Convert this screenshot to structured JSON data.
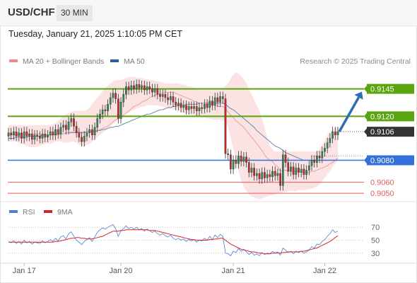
{
  "header": {
    "symbol": "USD/CHF",
    "timeframe": "30 MIN",
    "timestamp": "Tuesday, January 21, 2025 1:10:05 PM CET"
  },
  "legend": [
    {
      "label": "MA 20 + Bollinger Bands",
      "color": "#f08a8a"
    },
    {
      "label": "MA 50",
      "color": "#2e5e9e"
    }
  ],
  "credit": "Research © 2025 Trading Central",
  "rsi_legend": [
    {
      "label": "RSI",
      "color": "#4a7fd4"
    },
    {
      "label": "9MA",
      "color": "#d62728"
    }
  ],
  "colors": {
    "resistance": "#5aa50f",
    "pivot": "#3370d8",
    "support": "#e45a5a",
    "arrow": "#2d6eb2",
    "current_price": "#333333",
    "band_fill": "#fbe3e3"
  },
  "icons": [
    "arrow-up-right-icon",
    "triangle-left-icon"
  ],
  "chart_data": [
    {
      "type": "candlestick",
      "x_ticks": [
        "Jan 17",
        "Jan 20",
        "Jan 21",
        "Jan 22"
      ],
      "ylim": [
        0.9043,
        0.9166
      ],
      "current_price": "0.9106",
      "levels": [
        {
          "value": "0.9145",
          "kind": "resistance"
        },
        {
          "value": "0.9120",
          "kind": "resistance"
        },
        {
          "value": "0.9080",
          "kind": "pivot"
        },
        {
          "value": "0.9060",
          "kind": "support"
        },
        {
          "value": "0.9050",
          "kind": "support"
        }
      ],
      "forecast": {
        "from": 0.9106,
        "to": 0.9145,
        "direction": "up"
      },
      "close_series": [
        0.9105,
        0.9103,
        0.9106,
        0.9102,
        0.9105,
        0.91,
        0.9106,
        0.9102,
        0.9104,
        0.9099,
        0.9103,
        0.9102,
        0.91,
        0.9104,
        0.9101,
        0.9103,
        0.9106,
        0.9103,
        0.9108,
        0.9104,
        0.911,
        0.9112,
        0.9108,
        0.9115,
        0.9118,
        0.9111,
        0.9105,
        0.9101,
        0.9097,
        0.9102,
        0.9105,
        0.9108,
        0.9103,
        0.911,
        0.9118,
        0.9122,
        0.9126,
        0.9125,
        0.9131,
        0.9137,
        0.9141,
        0.9136,
        0.9118,
        0.9133,
        0.914,
        0.9147,
        0.9144,
        0.9148,
        0.9145,
        0.9149,
        0.9146,
        0.9148,
        0.9144,
        0.9147,
        0.9145,
        0.9142,
        0.9145,
        0.914,
        0.9138,
        0.914,
        0.9137,
        0.9135,
        0.9138,
        0.9133,
        0.913,
        0.9132,
        0.9128,
        0.913,
        0.9126,
        0.9129,
        0.9127,
        0.9129,
        0.9125,
        0.9128,
        0.9127,
        0.9131,
        0.9128,
        0.9134,
        0.913,
        0.9137,
        0.9133,
        0.9138,
        0.9136,
        0.9086,
        0.9085,
        0.9072,
        0.908,
        0.9077,
        0.9084,
        0.9079,
        0.9083,
        0.9078,
        0.9069,
        0.9073,
        0.9066,
        0.9068,
        0.9063,
        0.9069,
        0.9064,
        0.9067,
        0.9065,
        0.907,
        0.9066,
        0.9068,
        0.9057,
        0.9085,
        0.9078,
        0.907,
        0.9074,
        0.9067,
        0.9073,
        0.9069,
        0.9072,
        0.9067,
        0.9071,
        0.9075,
        0.908,
        0.9078,
        0.9084,
        0.9082,
        0.9088,
        0.9091,
        0.9096,
        0.91,
        0.9106,
        0.9103,
        0.9106
      ],
      "ma20_series": [
        0.9103,
        0.9103,
        0.9103,
        0.9103,
        0.9104,
        0.9104,
        0.9104,
        0.9104,
        0.9104,
        0.9104,
        0.9104,
        0.9104,
        0.9104,
        0.9103,
        0.9103,
        0.9103,
        0.9103,
        0.9103,
        0.9103,
        0.9103,
        0.9104,
        0.9104,
        0.9105,
        0.9105,
        0.9106,
        0.9106,
        0.9106,
        0.9106,
        0.9106,
        0.9106,
        0.9106,
        0.9106,
        0.9107,
        0.9107,
        0.9107,
        0.9108,
        0.9109,
        0.911,
        0.9111,
        0.9113,
        0.9115,
        0.9117,
        0.9118,
        0.9119,
        0.9121,
        0.9123,
        0.9125,
        0.9127,
        0.9129,
        0.913,
        0.9131,
        0.9133,
        0.9134,
        0.9135,
        0.9137,
        0.9138,
        0.9139,
        0.914,
        0.9141,
        0.9141,
        0.9142,
        0.9142,
        0.9142,
        0.9142,
        0.9141,
        0.914,
        0.9139,
        0.9138,
        0.9137,
        0.9136,
        0.9135,
        0.9134,
        0.9133,
        0.9132,
        0.9132,
        0.9132,
        0.9131,
        0.9131,
        0.913,
        0.913,
        0.9129,
        0.9129,
        0.9129,
        0.9127,
        0.9124,
        0.9121,
        0.9119,
        0.9116,
        0.9114,
        0.9112,
        0.911,
        0.9107,
        0.9104,
        0.9101,
        0.9098,
        0.9095,
        0.9092,
        0.9089,
        0.9085,
        0.9082,
        0.908,
        0.9079,
        0.9076,
        0.9074,
        0.907,
        0.9071,
        0.9071,
        0.907,
        0.907,
        0.907,
        0.907,
        0.9069,
        0.9069,
        0.9069,
        0.9069,
        0.9069,
        0.907,
        0.907,
        0.9071,
        0.9072,
        0.9073,
        0.9074,
        0.9075,
        0.9077,
        0.9078,
        0.908,
        0.9082
      ],
      "ma50_series": [
        0.91,
        0.91,
        0.91,
        0.9101,
        0.9101,
        0.9101,
        0.9101,
        0.9101,
        0.9102,
        0.9102,
        0.9102,
        0.9102,
        0.9102,
        0.9103,
        0.9103,
        0.9103,
        0.9103,
        0.9103,
        0.9104,
        0.9104,
        0.9104,
        0.9104,
        0.9105,
        0.9105,
        0.9105,
        0.9105,
        0.9105,
        0.9105,
        0.9105,
        0.9105,
        0.9106,
        0.9106,
        0.9106,
        0.9106,
        0.9107,
        0.9107,
        0.9108,
        0.9108,
        0.9109,
        0.911,
        0.911,
        0.9111,
        0.9111,
        0.9112,
        0.9113,
        0.9114,
        0.9115,
        0.9116,
        0.9117,
        0.9118,
        0.9119,
        0.912,
        0.9121,
        0.9122,
        0.9122,
        0.9123,
        0.9124,
        0.9125,
        0.9126,
        0.9126,
        0.9127,
        0.9128,
        0.9128,
        0.9129,
        0.9129,
        0.913,
        0.913,
        0.913,
        0.9131,
        0.9131,
        0.9131,
        0.9131,
        0.9131,
        0.9132,
        0.9132,
        0.9132,
        0.9132,
        0.9132,
        0.9132,
        0.9132,
        0.9132,
        0.9132,
        0.9132,
        0.9131,
        0.9129,
        0.9127,
        0.9126,
        0.9124,
        0.9122,
        0.912,
        0.9118,
        0.9116,
        0.9114,
        0.9112,
        0.911,
        0.9107,
        0.9105,
        0.9103,
        0.9101,
        0.9099,
        0.9097,
        0.9095,
        0.9093,
        0.9092,
        0.9091,
        0.9089,
        0.9087,
        0.9086,
        0.9085,
        0.9084,
        0.9083,
        0.9082,
        0.9081,
        0.908,
        0.908,
        0.908,
        0.908,
        0.908,
        0.908,
        0.908,
        0.908,
        0.908,
        0.908,
        0.908,
        0.908,
        0.908,
        0.908
      ],
      "bb_upper": [
        0.9112,
        0.9112,
        0.9112,
        0.9112,
        0.9112,
        0.9112,
        0.9112,
        0.9112,
        0.9112,
        0.9112,
        0.9112,
        0.9112,
        0.9112,
        0.9112,
        0.9112,
        0.9112,
        0.9112,
        0.9113,
        0.9114,
        0.9116,
        0.9118,
        0.912,
        0.9122,
        0.9123,
        0.9124,
        0.9125,
        0.9125,
        0.9125,
        0.9125,
        0.9125,
        0.9126,
        0.9128,
        0.9131,
        0.9134,
        0.9137,
        0.914,
        0.9143,
        0.9146,
        0.9148,
        0.915,
        0.9152,
        0.9153,
        0.9153,
        0.9153,
        0.9154,
        0.9155,
        0.9156,
        0.9156,
        0.9156,
        0.9155,
        0.9155,
        0.9155,
        0.9154,
        0.9154,
        0.9153,
        0.9153,
        0.9152,
        0.9152,
        0.9151,
        0.9151,
        0.915,
        0.915,
        0.915,
        0.915,
        0.915,
        0.915,
        0.9149,
        0.9149,
        0.9148,
        0.9147,
        0.9147,
        0.9146,
        0.9145,
        0.9145,
        0.9144,
        0.9144,
        0.9144,
        0.9144,
        0.9144,
        0.9144,
        0.9144,
        0.9145,
        0.9146,
        0.9148,
        0.915,
        0.9154,
        0.9158,
        0.916,
        0.9159,
        0.9157,
        0.9154,
        0.915,
        0.9145,
        0.914,
        0.9135,
        0.913,
        0.9125,
        0.9118,
        0.911,
        0.91,
        0.9093,
        0.909,
        0.9088,
        0.9088,
        0.9088,
        0.9088,
        0.9088,
        0.9088,
        0.9088,
        0.9088,
        0.9088,
        0.9088,
        0.9088,
        0.9088,
        0.9088,
        0.9088,
        0.9088,
        0.9088,
        0.9088,
        0.909,
        0.9094,
        0.9098,
        0.9103,
        0.9106,
        0.9108,
        0.9109,
        0.911
      ],
      "bb_lower": [
        0.9097,
        0.9097,
        0.9097,
        0.9097,
        0.9096,
        0.9095,
        0.9094,
        0.9093,
        0.9092,
        0.9092,
        0.9092,
        0.9092,
        0.9093,
        0.9094,
        0.9095,
        0.9095,
        0.9095,
        0.9096,
        0.9097,
        0.9097,
        0.9097,
        0.9096,
        0.9096,
        0.9096,
        0.9097,
        0.9097,
        0.9096,
        0.9094,
        0.9093,
        0.9093,
        0.9094,
        0.9095,
        0.9097,
        0.9099,
        0.9101,
        0.9103,
        0.9105,
        0.9107,
        0.9109,
        0.9111,
        0.9113,
        0.9115,
        0.9117,
        0.9119,
        0.9121,
        0.9122,
        0.9123,
        0.9125,
        0.9126,
        0.9127,
        0.9128,
        0.9129,
        0.9129,
        0.913,
        0.913,
        0.913,
        0.913,
        0.913,
        0.9129,
        0.9129,
        0.9128,
        0.9127,
        0.9127,
        0.9126,
        0.9125,
        0.9125,
        0.9124,
        0.9123,
        0.9123,
        0.9122,
        0.9121,
        0.9121,
        0.912,
        0.912,
        0.9119,
        0.9119,
        0.9118,
        0.9118,
        0.9117,
        0.9117,
        0.9117,
        0.9117,
        0.9116,
        0.9115,
        0.911,
        0.91,
        0.909,
        0.908,
        0.907,
        0.9062,
        0.9056,
        0.9052,
        0.9049,
        0.9047,
        0.9046,
        0.9045,
        0.9045,
        0.9045,
        0.9046,
        0.9047,
        0.9048,
        0.9048,
        0.9049,
        0.905,
        0.905,
        0.9051,
        0.9051,
        0.9052,
        0.9052,
        0.9052,
        0.9052,
        0.9053,
        0.9053,
        0.9053,
        0.9053,
        0.9054,
        0.9054,
        0.9055,
        0.9056,
        0.9058,
        0.9061,
        0.9064,
        0.9067,
        0.907,
        0.9074,
        0.9077,
        0.908
      ]
    },
    {
      "type": "line",
      "title": "RSI",
      "ylim": [
        20,
        80
      ],
      "y_ticks": [
        "70",
        "50",
        "30"
      ],
      "series": [
        {
          "name": "RSI",
          "values": [
            48,
            46,
            49,
            45,
            48,
            44,
            50,
            46,
            48,
            44,
            47,
            46,
            45,
            49,
            46,
            48,
            51,
            48,
            53,
            49,
            55,
            57,
            52,
            60,
            63,
            56,
            50,
            47,
            43,
            48,
            51,
            54,
            48,
            55,
            62,
            66,
            69,
            67,
            70,
            72,
            74,
            68,
            56,
            64,
            68,
            72,
            68,
            70,
            67,
            70,
            66,
            68,
            64,
            67,
            65,
            62,
            64,
            60,
            58,
            60,
            57,
            55,
            58,
            53,
            51,
            53,
            50,
            52,
            48,
            51,
            49,
            51,
            47,
            50,
            49,
            53,
            50,
            56,
            51,
            58,
            54,
            59,
            56,
            30,
            29,
            26,
            33,
            31,
            37,
            33,
            36,
            32,
            28,
            31,
            27,
            29,
            26,
            31,
            28,
            30,
            29,
            33,
            30,
            32,
            27,
            38,
            35,
            31,
            33,
            29,
            33,
            31,
            33,
            30,
            32,
            35,
            40,
            38,
            44,
            43,
            48,
            51,
            56,
            60,
            66,
            62,
            64
          ]
        },
        {
          "name": "9MA",
          "values": [
            47,
            47,
            47,
            47,
            47,
            47,
            47,
            47,
            47,
            47,
            47,
            47,
            47,
            47,
            47,
            47,
            47,
            47,
            48,
            48,
            49,
            50,
            51,
            52,
            53,
            53,
            54,
            54,
            53,
            53,
            52,
            52,
            52,
            53,
            54,
            55,
            56,
            58,
            60,
            62,
            64,
            64,
            64,
            65,
            65,
            66,
            66,
            66,
            66,
            66,
            66,
            66,
            66,
            66,
            65,
            65,
            65,
            64,
            63,
            62,
            61,
            60,
            59,
            58,
            57,
            56,
            55,
            54,
            53,
            52,
            51,
            51,
            50,
            50,
            50,
            50,
            50,
            51,
            51,
            52,
            52,
            53,
            53,
            50,
            47,
            44,
            42,
            40,
            38,
            36,
            35,
            34,
            33,
            32,
            32,
            31,
            30,
            30,
            29,
            29,
            29,
            30,
            30,
            30,
            30,
            31,
            31,
            32,
            32,
            32,
            32,
            32,
            33,
            33,
            34,
            35,
            36,
            37,
            38,
            40,
            42,
            44,
            46,
            48,
            51,
            54,
            57
          ]
        }
      ]
    }
  ]
}
